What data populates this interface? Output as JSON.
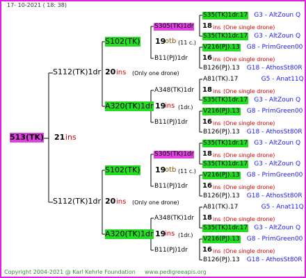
{
  "header": {
    "date": "17- 10-2021 ( 18: 38)"
  },
  "footer": {
    "copyright": "Copyright 2004-2021 @ Karl Kehrle Foundation",
    "site": "www.pedigreeapis.org"
  },
  "colors": {
    "border": "#e020e0",
    "highlight_green": "#22dd22",
    "highlight_magenta": "#e040e0",
    "num_red": "#dd0000",
    "breeder_blue": "#1a1aff",
    "otb_color": "#885500"
  },
  "root": {
    "label": "513(TK)",
    "count": "21",
    "unit": "ins"
  },
  "gen1": [
    {
      "label": "S112(TK)1dr",
      "count": "20",
      "unit": "ins",
      "note": "(Only one drone)"
    },
    {
      "label": "S112(TK)1dr",
      "count": "20",
      "unit": "ins",
      "note": "(Only one drone)"
    }
  ],
  "gen2": [
    {
      "label": "S102(TK)",
      "count": "19",
      "unit": "otb",
      "note": "(11 c.)"
    },
    {
      "label": "A320(TK)1dr",
      "count": "19",
      "unit": "ins",
      "note": "(1dr.)"
    },
    {
      "label": "S102(TK)",
      "count": "19",
      "unit": "otb",
      "note": "(11 c.)"
    },
    {
      "label": "A320(TK)1dr",
      "count": "19",
      "unit": "ins",
      "note": "(1dr.)"
    }
  ],
  "gen3": [
    {
      "label": "S305(TK)1dr"
    },
    {
      "label": "B11(PJ)1dr"
    },
    {
      "label": "A348(TK)1dr"
    },
    {
      "label": "B11(PJ)1dr"
    },
    {
      "label": "S305(TK)1dr"
    },
    {
      "label": "B11(PJ)1dr"
    },
    {
      "label": "A348(TK)1dr"
    },
    {
      "label": "B11(PJ)1dr"
    }
  ],
  "gen4": [
    {
      "top": "S35(TK)1dr.17",
      "top_breeder": "G3 - AltZoun Q",
      "count": "18",
      "unit": "ins",
      "note": "(One single drone)",
      "bottom": "S35(TK)1dr.17",
      "bottom_breeder": "G3 - AltZoun Q"
    },
    {
      "top": "V216(PJ).13",
      "top_breeder": "G8 - PrimGreen00",
      "count": "16",
      "unit": "ins",
      "note": "(One single drone)",
      "bottom": "B126(PJ).13",
      "bottom_breeder": "G18 - AthosSt80R"
    },
    {
      "top": "A81(TK).17",
      "top_breeder": "G5 - Anat11Q",
      "count": "18",
      "unit": "ins",
      "note": "(One single drone)",
      "bottom": "S35(TK)1dr.17",
      "bottom_breeder": "G3 - AltZoun Q"
    },
    {
      "top": "V216(PJ).13",
      "top_breeder": "G8 - PrimGreen00",
      "count": "16",
      "unit": "ins",
      "note": "(One single drone)",
      "bottom": "B126(PJ).13",
      "bottom_breeder": "G18 - AthosSt80R"
    },
    {
      "top": "S35(TK)1dr.17",
      "top_breeder": "G3 - AltZoun Q",
      "count": "18",
      "unit": "ins",
      "note": "(One single drone)",
      "bottom": "S35(TK)1dr.17",
      "bottom_breeder": "G3 - AltZoun Q"
    },
    {
      "top": "V216(PJ).13",
      "top_breeder": "G8 - PrimGreen00",
      "count": "16",
      "unit": "ins",
      "note": "(One single drone)",
      "bottom": "B126(PJ).13",
      "bottom_breeder": "G18 - AthosSt80R"
    },
    {
      "top": "A81(TK).17",
      "top_breeder": "G5 - Anat11Q",
      "count": "18",
      "unit": "ins",
      "note": "(One single drone)",
      "bottom": "S35(TK)1dr.17",
      "bottom_breeder": "G3 - AltZoun Q"
    },
    {
      "top": "V216(PJ).13",
      "top_breeder": "G8 - PrimGreen00",
      "count": "16",
      "unit": "ins",
      "note": "(One single drone)",
      "bottom": "B126(PJ).13",
      "bottom_breeder": "G18 - AthosSt80R"
    }
  ]
}
